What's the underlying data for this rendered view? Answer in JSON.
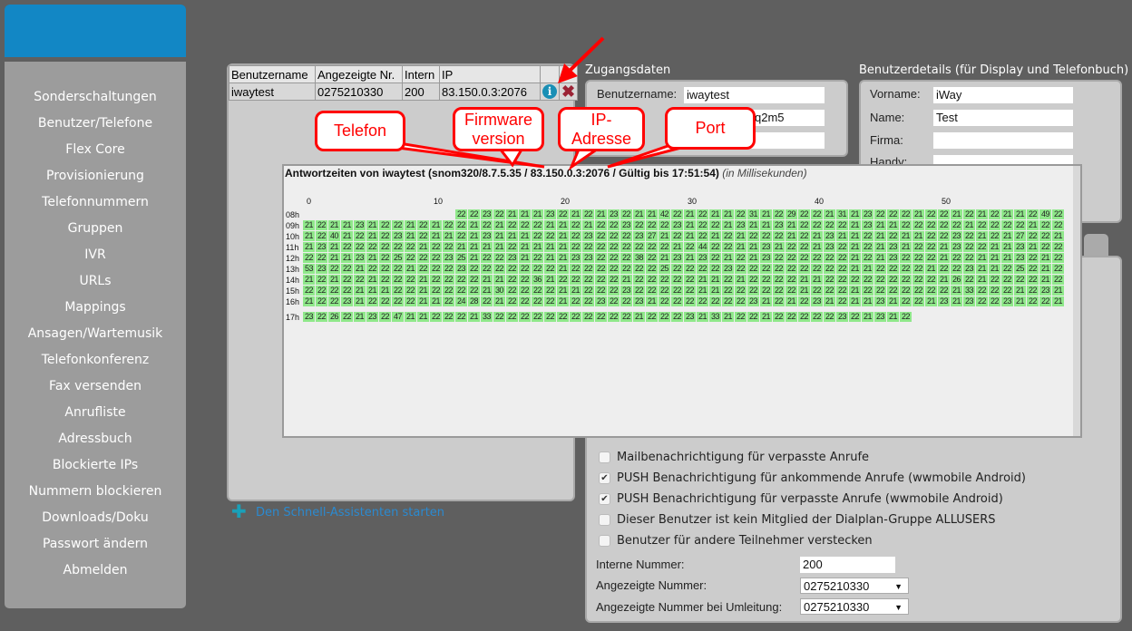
{
  "sidebar": {
    "items": [
      "Sonderschaltungen",
      "Benutzer/Telefone",
      "Flex Core",
      "Provisionierung",
      "Telefonnummern",
      "Gruppen",
      "IVR",
      "URLs",
      "Mappings",
      "Ansagen/Wartemusik",
      "Telefonkonferenz",
      "Fax versenden",
      "Anrufliste",
      "Adressbuch",
      "Blockierte IPs",
      "Nummern blockieren",
      "Downloads/Doku",
      "Passwort ändern",
      "Abmelden"
    ],
    "brand_color": "#1287c5"
  },
  "users_table": {
    "headers": [
      "Benutzername",
      "Angezeigte Nr.",
      "Intern",
      "IP"
    ],
    "rows": [
      {
        "cells": [
          "iwaytest",
          "0275210330",
          "200",
          "83.150.0.3:2076"
        ],
        "info_icon": "info-icon",
        "delete_icon": "delete-x-icon"
      }
    ]
  },
  "wizard_link": "Den Schnell-Assistenten starten",
  "zugang": {
    "title": "Zugangsdaten",
    "username_label": "Benutzername:",
    "username": "iwaytest",
    "password_value": "q2m5"
  },
  "details": {
    "title": "Benutzerdetails (für Display und Telefonbuch)",
    "fields": [
      {
        "label": "Vorname:",
        "value": "iWay"
      },
      {
        "label": "Name:",
        "value": "Test"
      },
      {
        "label": "Firma:",
        "value": ""
      },
      {
        "label": "Handy:",
        "value": ""
      }
    ]
  },
  "options": {
    "checkboxes": [
      {
        "label": "Mailbenachrichtigung für verpasste Anrufe",
        "checked": false
      },
      {
        "label": "PUSH Benachrichtigung für ankommende Anrufe (wwmobile Android)",
        "checked": true
      },
      {
        "label": "PUSH Benachrichtigung für verpasste Anrufe (wwmobile Android)",
        "checked": true
      },
      {
        "label": "Dieser Benutzer ist kein Mitglied der Dialplan-Gruppe ALLUSERS",
        "checked": false
      },
      {
        "label": "Benutzer für andere Teilnehmer verstecken",
        "checked": false
      }
    ],
    "interne_label": "Interne Nummer:",
    "interne_value": "200",
    "angezeigt_label": "Angezeigte Nummer:",
    "angezeigt_value": "0275210330",
    "umleitung_label": "Angezeigte Nummer bei Umleitung:",
    "umleitung_value": "0275210330"
  },
  "popup": {
    "title": "Antwortzeiten von iwaytest (snom320/8.7.5.35 / 83.150.0.3:2076 / Gültig bis 17:51:54)",
    "unit": "(in Millisekunden)",
    "minute_labels": [
      "0",
      "10",
      "20",
      "30",
      "40",
      "50"
    ],
    "cell_color": "#8fe88a",
    "rows": [
      {
        "hour": "08h",
        "start": 12,
        "values": [
          22,
          22,
          23,
          22,
          21,
          21,
          21,
          23,
          22,
          21,
          22,
          21,
          23,
          22,
          21,
          21,
          42,
          22,
          21,
          22,
          21,
          21,
          22,
          31,
          21,
          22,
          29,
          22,
          22,
          21,
          31,
          21,
          23,
          22,
          22,
          22,
          21,
          22,
          22,
          21,
          22,
          21,
          22,
          21,
          21,
          22,
          49,
          22
        ]
      },
      {
        "hour": "09h",
        "start": 0,
        "values": [
          21,
          22,
          21,
          21,
          23,
          21,
          22,
          22,
          21,
          22,
          21,
          22,
          22,
          21,
          22,
          21,
          22,
          22,
          22,
          21,
          21,
          22,
          21,
          22,
          22,
          23,
          22,
          22,
          22,
          23,
          21,
          22,
          22,
          21,
          23,
          21,
          21,
          23,
          21,
          22,
          22,
          22,
          22,
          21,
          23,
          21,
          21,
          22,
          22,
          22,
          22,
          22,
          21,
          22,
          22,
          22,
          22,
          21,
          22,
          22
        ]
      },
      {
        "hour": "10h",
        "start": 0,
        "values": [
          21,
          22,
          40,
          21,
          22,
          21,
          22,
          23,
          21,
          22,
          21,
          21,
          22,
          21,
          23,
          21,
          21,
          21,
          22,
          22,
          21,
          22,
          23,
          22,
          22,
          22,
          23,
          27,
          21,
          22,
          21,
          22,
          21,
          22,
          21,
          22,
          22,
          22,
          21,
          22,
          21,
          23,
          21,
          21,
          22,
          21,
          22,
          21,
          21,
          22,
          22,
          23,
          22,
          21,
          22,
          21,
          27,
          22,
          22,
          21
        ]
      },
      {
        "hour": "11h",
        "start": 0,
        "values": [
          21,
          23,
          21,
          22,
          22,
          22,
          22,
          22,
          22,
          21,
          22,
          22,
          21,
          21,
          21,
          21,
          22,
          21,
          21,
          21,
          21,
          22,
          22,
          22,
          22,
          22,
          22,
          22,
          22,
          21,
          22,
          44,
          22,
          22,
          21,
          21,
          23,
          21,
          22,
          22,
          21,
          23,
          22,
          21,
          22,
          21,
          23,
          21,
          22,
          22,
          21,
          23,
          22,
          22,
          21,
          21,
          23,
          21,
          22,
          22
        ]
      },
      {
        "hour": "12h",
        "start": 0,
        "values": [
          22,
          22,
          21,
          21,
          23,
          21,
          22,
          25,
          22,
          22,
          22,
          23,
          25,
          21,
          22,
          22,
          23,
          21,
          22,
          21,
          21,
          23,
          23,
          22,
          22,
          22,
          38,
          22,
          21,
          23,
          21,
          23,
          22,
          21,
          22,
          21,
          23,
          22,
          22,
          22,
          22,
          22,
          22,
          21,
          22,
          21,
          23,
          22,
          22,
          22,
          21,
          22,
          22,
          21,
          21,
          21,
          23,
          22,
          21,
          22
        ]
      },
      {
        "hour": "13h",
        "start": 0,
        "values": [
          53,
          23,
          22,
          22,
          21,
          22,
          22,
          22,
          21,
          22,
          22,
          22,
          23,
          22,
          22,
          22,
          22,
          22,
          22,
          22,
          21,
          22,
          22,
          22,
          22,
          22,
          22,
          22,
          25,
          22,
          22,
          22,
          22,
          23,
          22,
          22,
          22,
          22,
          22,
          22,
          22,
          22,
          22,
          21,
          21,
          22,
          22,
          22,
          22,
          21,
          22,
          22,
          23,
          21,
          21,
          22,
          25,
          22,
          21,
          22
        ]
      },
      {
        "hour": "14h",
        "start": 0,
        "values": [
          21,
          22,
          21,
          22,
          22,
          21,
          22,
          22,
          22,
          21,
          22,
          22,
          22,
          22,
          21,
          21,
          22,
          22,
          36,
          21,
          22,
          22,
          22,
          22,
          22,
          21,
          22,
          22,
          22,
          22,
          22,
          21,
          21,
          22,
          21,
          22,
          22,
          22,
          22,
          21,
          21,
          22,
          22,
          22,
          22,
          22,
          22,
          22,
          22,
          22,
          21,
          26,
          22,
          21,
          22,
          22,
          22,
          22,
          21,
          22
        ]
      },
      {
        "hour": "15h",
        "start": 0,
        "values": [
          22,
          22,
          22,
          22,
          21,
          21,
          21,
          22,
          22,
          21,
          22,
          22,
          22,
          22,
          21,
          30,
          22,
          22,
          22,
          22,
          21,
          21,
          22,
          22,
          22,
          23,
          22,
          22,
          22,
          22,
          22,
          21,
          21,
          22,
          22,
          22,
          22,
          22,
          22,
          21,
          22,
          22,
          22,
          21,
          22,
          22,
          22,
          22,
          22,
          22,
          22,
          21,
          33,
          22,
          22,
          22,
          21,
          22,
          23,
          21
        ]
      },
      {
        "hour": "16h",
        "start": 0,
        "values": [
          21,
          22,
          22,
          23,
          21,
          22,
          22,
          22,
          22,
          21,
          21,
          22,
          24,
          28,
          22,
          21,
          22,
          22,
          22,
          22,
          21,
          22,
          22,
          23,
          22,
          22,
          23,
          21,
          22,
          22,
          22,
          22,
          22,
          22,
          22,
          23,
          21,
          22,
          21,
          22,
          23,
          21,
          22,
          21,
          21,
          23,
          21,
          22,
          22,
          21,
          23,
          21,
          23,
          22,
          22,
          23,
          21,
          22,
          22,
          21
        ]
      },
      {
        "hour": "17h",
        "start": 0,
        "values": [
          23,
          22,
          26,
          22,
          21,
          23,
          22,
          47,
          21,
          21,
          22,
          22,
          22,
          21,
          33,
          22,
          22,
          22,
          22,
          22,
          22,
          22,
          22,
          22,
          22,
          22,
          21,
          22,
          22,
          22,
          23,
          21,
          33,
          21,
          22,
          22,
          21,
          22,
          22,
          22,
          22,
          22,
          23,
          22,
          21,
          23,
          21,
          22
        ]
      }
    ]
  },
  "annotations": {
    "telefon": "Telefon",
    "firmware": "Firmware version",
    "ip": "IP-Adresse",
    "port": "Port",
    "color": "#ff0000"
  }
}
